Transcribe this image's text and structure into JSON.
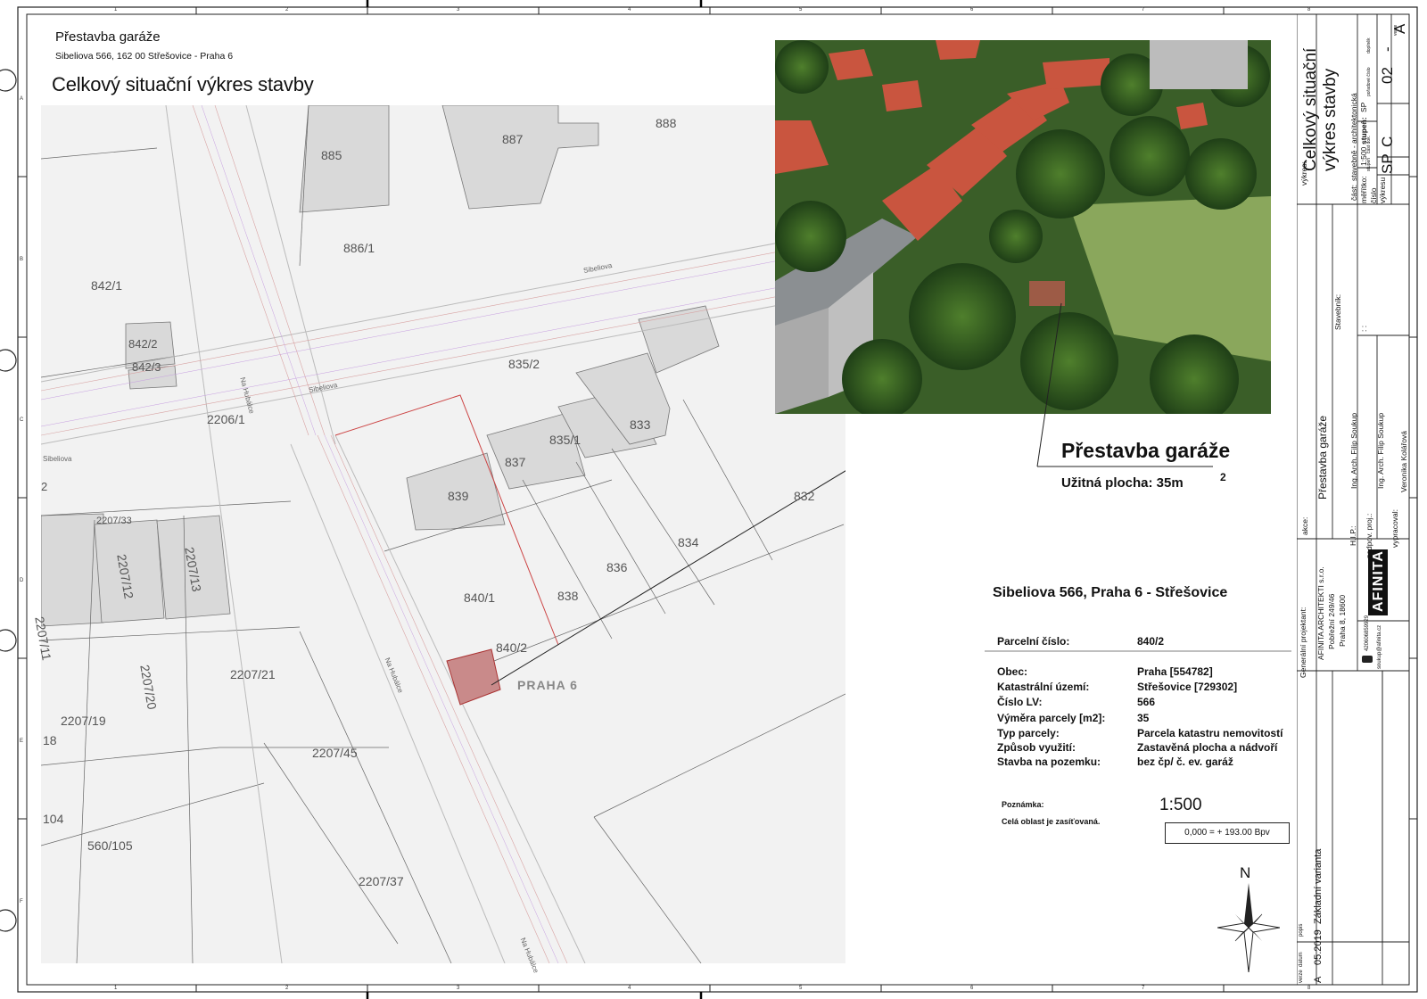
{
  "header": {
    "project_title": "Přestavba garáže",
    "address_line": "Sibeliova 566, 162 00 Střešovice - Praha 6",
    "drawing_title": "Celkový situační výkres stavby"
  },
  "map_labels": {
    "parcels": [
      "885",
      "887",
      "888",
      "886/1",
      "842/1",
      "842/2",
      "842/3",
      "835/2",
      "2206/1",
      "833",
      "835/1",
      "837",
      "839",
      "832",
      "834",
      "836",
      "838",
      "840/1",
      "840/2",
      "2207/33",
      "2207/11",
      "2207/12",
      "2207/13",
      "2207/21",
      "2207/19",
      "2207/20",
      "2207/45",
      "18",
      "104",
      "560/105",
      "2207/37"
    ],
    "streets": [
      "Sibeliova",
      "Na Hubálce",
      "Sibeliova",
      "Na Hubálce",
      "Na Hubálce",
      "Sibeliova"
    ],
    "district": "PRAHA 6",
    "misc": "2"
  },
  "building": {
    "title": "Přestavba garáže",
    "area_label": "Užitná plocha: 35m",
    "area_sup": "2"
  },
  "parcel_info": {
    "address": "Sibeliova 566, Praha 6 - Střešovice",
    "parcel_no_label": "Parcelní číslo:",
    "parcel_no_value": "840/2",
    "rows": [
      {
        "label": "Obec:",
        "value": "Praha [554782]"
      },
      {
        "label": "Katastrální území:",
        "value": "Střešovice [729302]"
      },
      {
        "label": "Číslo LV:",
        "value": "566"
      },
      {
        "label": "Výměra parcely [m2]:",
        "value": "35"
      },
      {
        "label": "Typ parcely:",
        "value": "Parcela katastru nemovitostí"
      },
      {
        "label": "Způsob využití:",
        "value": "Zastavěná plocha a nádvoří"
      },
      {
        "label": "Stavba na pozemku:",
        "value": "bez čp/ č. ev. garáž"
      }
    ],
    "note_label": "Poznámka:",
    "note_text": "Celá oblast je zasíťovaná.",
    "scale": "1:500",
    "elevation": "0,000 = + 193.00 Bpv",
    "north": "N"
  },
  "titleblock": {
    "vykres_label": "výkres:",
    "vykres_value_1": "Celkový situační",
    "vykres_value_2": "výkres stavby",
    "cast_label": "část:",
    "cast_value": "stavebně - architektonická",
    "meritko_label": "měřítko:",
    "meritko_value": "1:500",
    "stupen_label": "stupeň:",
    "stupen_value": "SP",
    "cislo_label_1": "číslo",
    "cislo_label_2": "výkresu",
    "cislo_sp": "SP",
    "cislo_c": "C",
    "cislo_02": "02",
    "cislo_dash": "-",
    "cislo_a": "A",
    "small_heads": [
      "stupeň",
      "část dok.",
      "pořadové číslo",
      "doplněk",
      "verze"
    ],
    "stavebnik_label": "Stavebník:",
    "stavebnik_colon": ": :",
    "akce_label": "akce:",
    "akce_value": "Přestavba garáže",
    "hip_label": "H.I.P.:",
    "hip_value": "Ing. Arch. Filip Soukup",
    "zodpov_label": "zodpov. proj.:",
    "zodpov_value": "Ing. Arch. Filip Soukup",
    "vypracoval_label": "vypracoval:",
    "vypracoval_value": "Veronika Kolářová",
    "gen_label": "Generální projektant:",
    "gen_line1": "AFINITA ARCHITEKTI s.r.o.",
    "gen_line2": "Pobřežní 249/46",
    "gen_line3": "Praha 8, 18600",
    "phone": "420606859929",
    "email": "soukup@afinita.cz",
    "logo": "AFINITA",
    "verze_head": "verze",
    "datum_head": "datum",
    "popis_head": "popis",
    "verze_val": "A",
    "datum_val": "05.2019",
    "popis_val": "Základní varianta"
  },
  "frame": {
    "col_ticks": [
      "1",
      "2",
      "3",
      "4",
      "5",
      "6",
      "7",
      "8"
    ],
    "row_ticks": [
      "A",
      "B",
      "C",
      "D",
      "E",
      "F"
    ]
  }
}
